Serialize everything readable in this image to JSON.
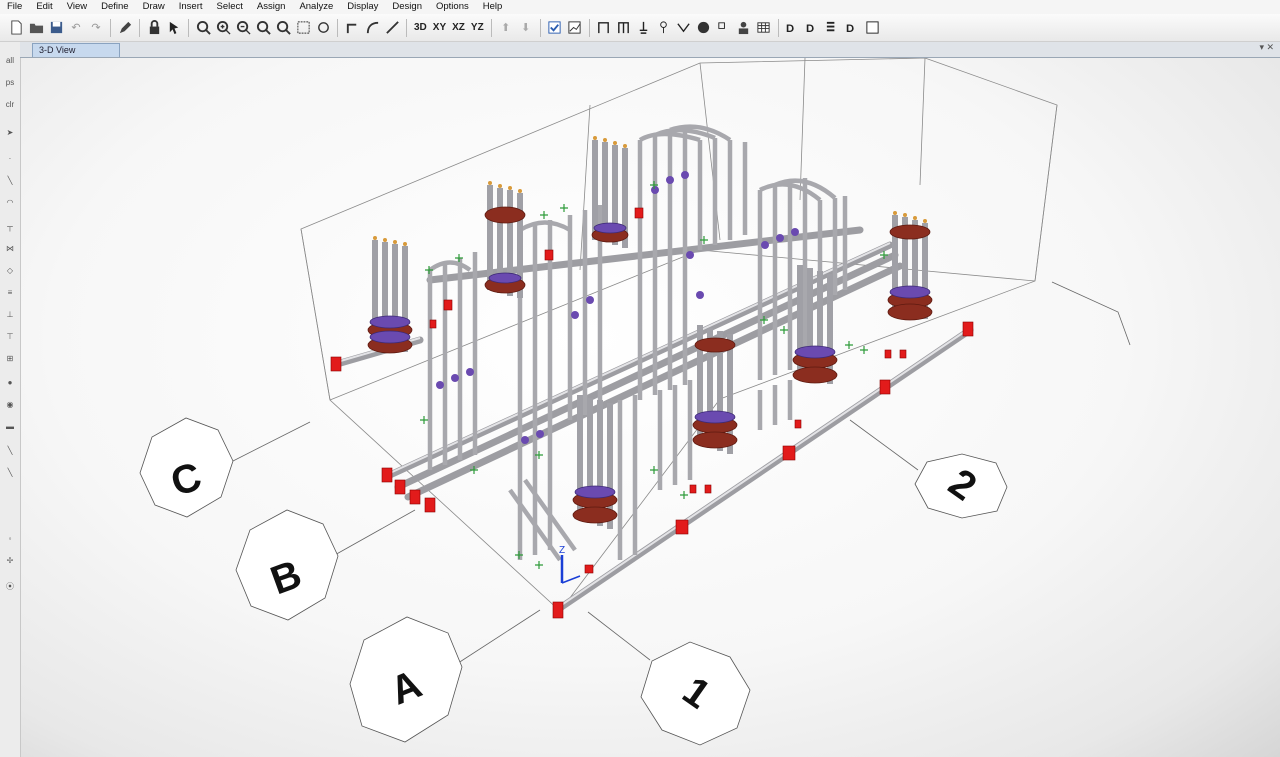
{
  "menu": [
    "File",
    "Edit",
    "View",
    "Define",
    "Draw",
    "Insert",
    "Select",
    "Assign",
    "Analyze",
    "Display",
    "Design",
    "Options",
    "Help"
  ],
  "toolbar": {
    "view_3d": "3D",
    "view_xy": "XY",
    "view_xz": "XZ",
    "view_yz": "YZ"
  },
  "tab": {
    "label": "3-D View"
  },
  "tab_controls": "▾ ✕",
  "left_tools": {
    "all": "all",
    "ps": "ps",
    "clr": "clr"
  },
  "grid_labels": {
    "a": "A",
    "b": "B",
    "c": "C",
    "one": "1",
    "two": "2"
  },
  "axis_label": "Z",
  "colors": {
    "pipe": "#b9b9bd",
    "flange": "#8b2d1f",
    "ring": "#6a4ab0",
    "support": "#e21b1b",
    "node": "#2e9b3a",
    "axis": "#1a3fd6"
  }
}
